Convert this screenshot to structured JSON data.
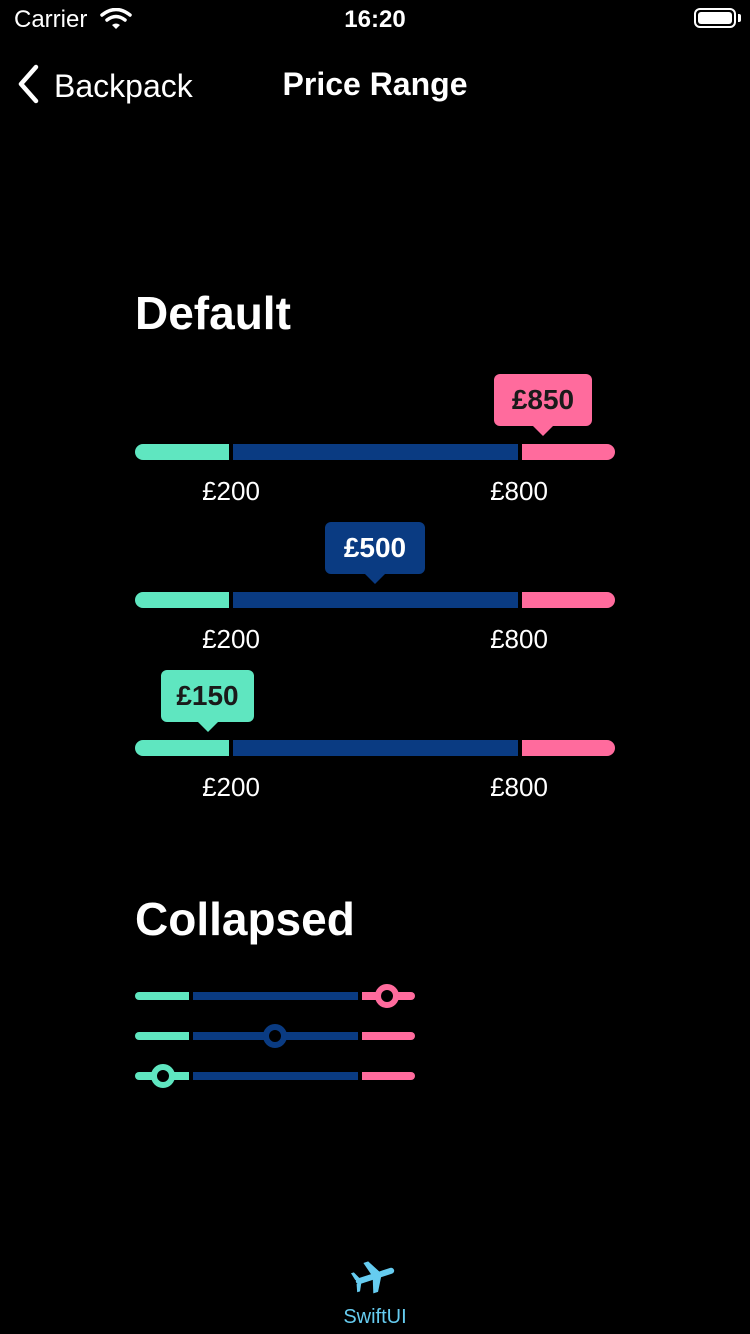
{
  "status": {
    "carrier": "Carrier",
    "time": "16:20"
  },
  "nav": {
    "back_label": "Backpack",
    "title": "Price Range"
  },
  "sections": {
    "default_title": "Default",
    "collapsed_title": "Collapsed"
  },
  "price_range": {
    "min_label": "£200",
    "max_label": "£800",
    "default_sliders": [
      {
        "value_label": "£850",
        "state": "above"
      },
      {
        "value_label": "£500",
        "state": "within"
      },
      {
        "value_label": "£150",
        "state": "below"
      }
    ],
    "collapsed_sliders": [
      {
        "state": "above"
      },
      {
        "state": "within"
      },
      {
        "state": "below"
      }
    ]
  },
  "tabbar": {
    "tab_label": "SwiftUI",
    "tab_icon": "airplane-icon"
  },
  "colors": {
    "below": "#5fe6c0",
    "within": "#0a3b82",
    "above": "#ff6b9d",
    "tab_accent": "#66ccf0"
  }
}
